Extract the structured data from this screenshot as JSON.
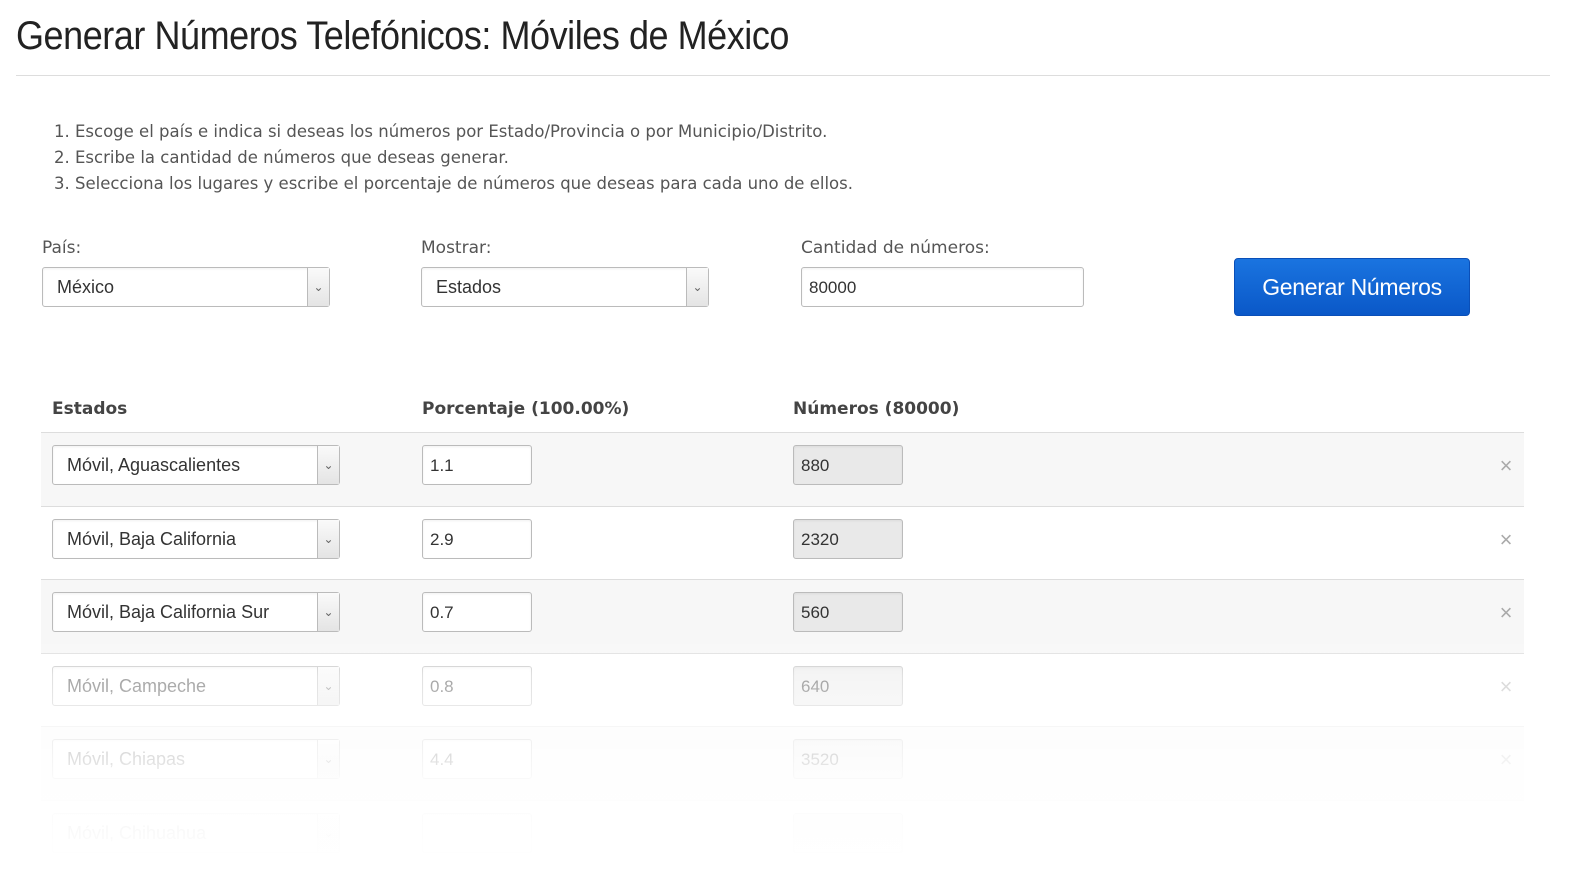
{
  "page": {
    "title": "Generar Números Telefónicos: Móviles de México",
    "instructions": [
      "1. Escoge el país e indica si deseas los números por Estado/Provincia o por Municipio/Distrito.",
      "2. Escribe la cantidad de números que deseas generar.",
      "3. Selecciona los lugares y escribe el porcentaje de números que deseas para cada uno de ellos."
    ]
  },
  "form": {
    "country_label": "País:",
    "country_value": "México",
    "show_label": "Mostrar:",
    "show_value": "Estados",
    "quantity_label": "Cantidad de números:",
    "quantity_value": "80000",
    "generate_label": "Generar Números"
  },
  "table": {
    "headers": [
      "Estados",
      "Porcentaje (100.00%)",
      "Números (80000)"
    ],
    "rows": [
      {
        "place": "Móvil, Aguascalientes",
        "percent": "1.1",
        "numbers": "880"
      },
      {
        "place": "Móvil, Baja California",
        "percent": "2.9",
        "numbers": "2320"
      },
      {
        "place": "Móvil, Baja California Sur",
        "percent": "0.7",
        "numbers": "560"
      },
      {
        "place": "Móvil, Campeche",
        "percent": "0.8",
        "numbers": "640"
      },
      {
        "place": "Móvil, Chiapas",
        "percent": "4.4",
        "numbers": "3520"
      },
      {
        "place": "Móvil, Chihuahua",
        "percent": "",
        "numbers": ""
      }
    ],
    "remove_symbol": "×"
  },
  "icons": {
    "dropdown": "chevron-down-icon",
    "remove": "close-icon"
  }
}
